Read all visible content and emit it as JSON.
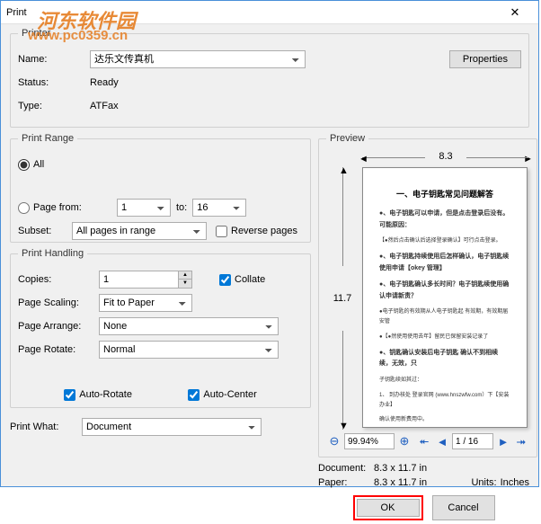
{
  "title": "Print",
  "watermark": "河东软件园",
  "watermark_url": "www.pc0359.cn",
  "printer": {
    "legend": "Printer",
    "name_label": "Name:",
    "name_value": "达乐文传真机",
    "properties_btn": "Properties",
    "status_label": "Status:",
    "status_value": "Ready",
    "type_label": "Type:",
    "type_value": "ATFax"
  },
  "range": {
    "legend": "Print Range",
    "all_label": "All",
    "page_from_label": "Page from:",
    "from_value": "1",
    "to_label": "to:",
    "to_value": "16",
    "subset_label": "Subset:",
    "subset_value": "All pages in range",
    "reverse_label": "Reverse pages"
  },
  "handling": {
    "legend": "Print Handling",
    "copies_label": "Copies:",
    "copies_value": "1",
    "collate_label": "Collate",
    "scaling_label": "Page Scaling:",
    "scaling_value": "Fit to Paper",
    "arrange_label": "Page Arrange:",
    "arrange_value": "None",
    "rotate_label": "Page Rotate:",
    "rotate_value": "Normal",
    "auto_rotate_label": "Auto-Rotate",
    "auto_center_label": "Auto-Center"
  },
  "print_what": {
    "label": "Print What:",
    "value": "Document"
  },
  "preview": {
    "legend": "Preview",
    "width": "8.3",
    "height": "11.7",
    "zoom": "99.94%",
    "page_indicator": "1 / 16",
    "doc_title": "一、电子钥匙常见问题解答",
    "document_label": "Document:",
    "document_value": "8.3 x 11.7 in",
    "paper_label": "Paper:",
    "paper_value": "8.3 x 11.7 in",
    "units_label": "Units:",
    "units_value": "Inches"
  },
  "buttons": {
    "ok": "OK",
    "cancel": "Cancel"
  }
}
